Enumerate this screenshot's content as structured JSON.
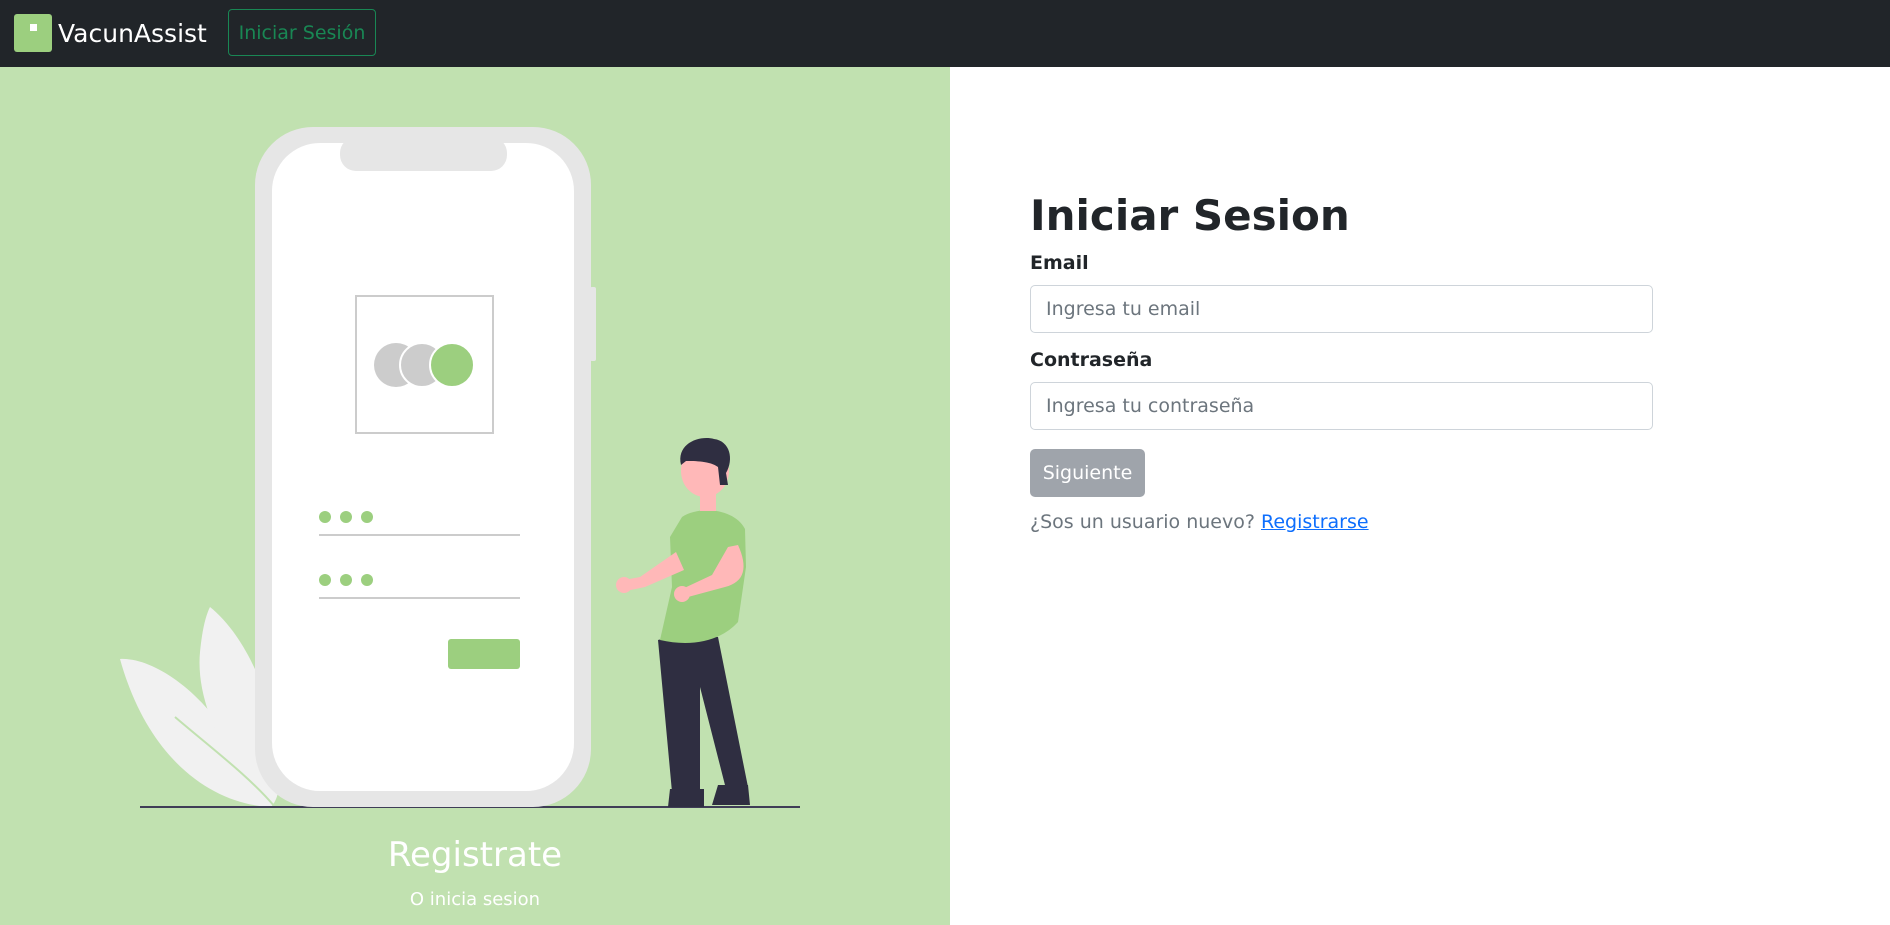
{
  "navbar": {
    "brand": "VacunAssist",
    "login_button": "Iniciar Sesión"
  },
  "left_panel": {
    "title": "Registrate",
    "subtitle": "O inicia sesion"
  },
  "form": {
    "title": "Iniciar Sesion",
    "email_label": "Email",
    "email_placeholder": "Ingresa tu email",
    "password_label": "Contraseña",
    "password_placeholder": "Ingresa tu contraseña",
    "submit_label": "Siguiente",
    "register_prompt": "¿Sos un usuario nuevo?",
    "register_link": "Registrarse"
  },
  "colors": {
    "navbar_bg": "#212529",
    "panel_green": "#c1e1b0",
    "accent_green": "#9ccf7f",
    "outline_green": "#198754",
    "link_blue": "#0d6efd",
    "button_gray": "#9fa4ab"
  },
  "icons": [
    "app-logo-icon",
    "login-illustration"
  ]
}
